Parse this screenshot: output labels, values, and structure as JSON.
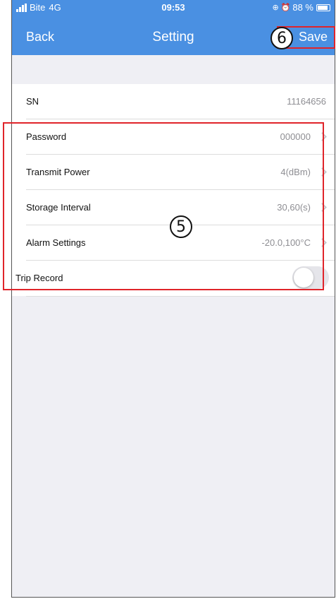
{
  "status_bar": {
    "carrier": "Bite",
    "network": "4G",
    "time": "09:53",
    "battery": "88 %",
    "battery_level": 0.88
  },
  "nav": {
    "back_label": "Back",
    "title": "Setting",
    "save_label": "Save"
  },
  "annotations": {
    "callout_save": "6",
    "callout_settings": "5"
  },
  "settings": {
    "sn": {
      "label": "SN",
      "value": "11164656"
    },
    "items": [
      {
        "label": "Password",
        "value": "000000"
      },
      {
        "label": "Transmit Power",
        "value": "4(dBm)"
      },
      {
        "label": "Storage Interval",
        "value": "30,60(s)"
      },
      {
        "label": "Alarm Settings",
        "value": "-20.0,100°C"
      }
    ],
    "trip_record": {
      "label": "Trip Record",
      "enabled": false
    }
  },
  "colors": {
    "header": "#4a90e2",
    "highlight": "#e0242a",
    "background": "#efeff4"
  }
}
